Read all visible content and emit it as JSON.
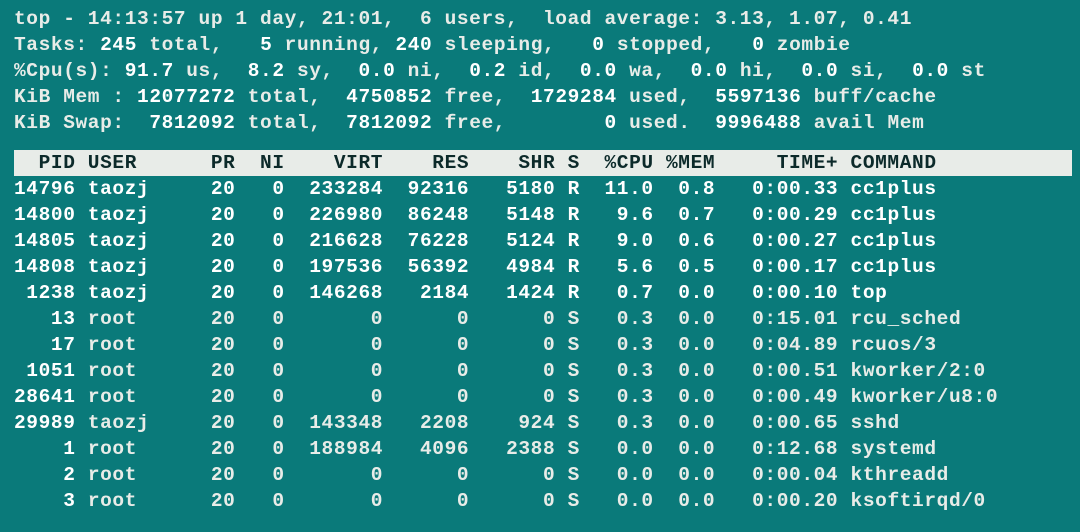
{
  "header": {
    "line1": "top - 14:13:57 up 1 day, 21:01,  6 users,  load average: 3.13, 1.07, 0.41",
    "line2_pre": "Tasks: ",
    "line2_total": "245",
    "line2_post_total": " total,   ",
    "line2_running": "5",
    "line2_post_running": " running, ",
    "line2_sleeping": "240",
    "line2_post_sleeping": " sleeping,   ",
    "line2_stopped": "0",
    "line2_post_stopped": " stopped,   ",
    "line2_zombie": "0",
    "line2_post_zombie": " zombie",
    "line3_pre": "%Cpu(s): ",
    "line3_us": "91.7",
    "line3_post_us": " us,  ",
    "line3_sy": "8.2",
    "line3_post_sy": " sy,  ",
    "line3_ni": "0.0",
    "line3_post_ni": " ni,  ",
    "line3_id": "0.2",
    "line3_post_id": " id,  ",
    "line3_wa": "0.0",
    "line3_post_wa": " wa,  ",
    "line3_hi": "0.0",
    "line3_post_hi": " hi,  ",
    "line3_si": "0.0",
    "line3_post_si": " si,  ",
    "line3_st": "0.0",
    "line3_post_st": " st",
    "line4_pre": "KiB Mem : ",
    "line4_total": "12077272",
    "line4_post_total": " total,  ",
    "line4_free": "4750852",
    "line4_post_free": " free,  ",
    "line4_used": "1729284",
    "line4_post_used": " used,  ",
    "line4_buff": "5597136",
    "line4_post_buff": " buff/cache",
    "line5_pre": "KiB Swap:  ",
    "line5_total": "7812092",
    "line5_post_total": " total,  ",
    "line5_free": "7812092",
    "line5_post_free": " free,        ",
    "line5_used": "0",
    "line5_post_used": " used.  ",
    "line5_avail": "9996488",
    "line5_post_avail": " avail Mem"
  },
  "columns": "  PID USER      PR  NI    VIRT    RES    SHR S  %CPU %MEM     TIME+ COMMAND     ",
  "rows": [
    {
      "pid": "14796",
      "user": "taozj",
      "pr": "20",
      "ni": "0",
      "virt": "233284",
      "res": "92316",
      "shr": "5180",
      "s": "R",
      "cpu": "11.0",
      "mem": "0.8",
      "time": "0:00.33",
      "cmd": "cc1plus",
      "bold": true
    },
    {
      "pid": "14800",
      "user": "taozj",
      "pr": "20",
      "ni": "0",
      "virt": "226980",
      "res": "86248",
      "shr": "5148",
      "s": "R",
      "cpu": "9.6",
      "mem": "0.7",
      "time": "0:00.29",
      "cmd": "cc1plus",
      "bold": true
    },
    {
      "pid": "14805",
      "user": "taozj",
      "pr": "20",
      "ni": "0",
      "virt": "216628",
      "res": "76228",
      "shr": "5124",
      "s": "R",
      "cpu": "9.0",
      "mem": "0.6",
      "time": "0:00.27",
      "cmd": "cc1plus",
      "bold": true
    },
    {
      "pid": "14808",
      "user": "taozj",
      "pr": "20",
      "ni": "0",
      "virt": "197536",
      "res": "56392",
      "shr": "4984",
      "s": "R",
      "cpu": "5.6",
      "mem": "0.5",
      "time": "0:00.17",
      "cmd": "cc1plus",
      "bold": true
    },
    {
      "pid": "1238",
      "user": "taozj",
      "pr": "20",
      "ni": "0",
      "virt": "146268",
      "res": "2184",
      "shr": "1424",
      "s": "R",
      "cpu": "0.7",
      "mem": "0.0",
      "time": "0:00.10",
      "cmd": "top",
      "bold": true
    },
    {
      "pid": "13",
      "user": "root",
      "pr": "20",
      "ni": "0",
      "virt": "0",
      "res": "0",
      "shr": "0",
      "s": "S",
      "cpu": "0.3",
      "mem": "0.0",
      "time": "0:15.01",
      "cmd": "rcu_sched",
      "bold": false
    },
    {
      "pid": "17",
      "user": "root",
      "pr": "20",
      "ni": "0",
      "virt": "0",
      "res": "0",
      "shr": "0",
      "s": "S",
      "cpu": "0.3",
      "mem": "0.0",
      "time": "0:04.89",
      "cmd": "rcuos/3",
      "bold": false
    },
    {
      "pid": "1051",
      "user": "root",
      "pr": "20",
      "ni": "0",
      "virt": "0",
      "res": "0",
      "shr": "0",
      "s": "S",
      "cpu": "0.3",
      "mem": "0.0",
      "time": "0:00.51",
      "cmd": "kworker/2:0",
      "bold": false
    },
    {
      "pid": "28641",
      "user": "root",
      "pr": "20",
      "ni": "0",
      "virt": "0",
      "res": "0",
      "shr": "0",
      "s": "S",
      "cpu": "0.3",
      "mem": "0.0",
      "time": "0:00.49",
      "cmd": "kworker/u8:0",
      "bold": false
    },
    {
      "pid": "29989",
      "user": "taozj",
      "pr": "20",
      "ni": "0",
      "virt": "143348",
      "res": "2208",
      "shr": "924",
      "s": "S",
      "cpu": "0.3",
      "mem": "0.0",
      "time": "0:00.65",
      "cmd": "sshd",
      "bold": false
    },
    {
      "pid": "1",
      "user": "root",
      "pr": "20",
      "ni": "0",
      "virt": "188984",
      "res": "4096",
      "shr": "2388",
      "s": "S",
      "cpu": "0.0",
      "mem": "0.0",
      "time": "0:12.68",
      "cmd": "systemd",
      "bold": false
    },
    {
      "pid": "2",
      "user": "root",
      "pr": "20",
      "ni": "0",
      "virt": "0",
      "res": "0",
      "shr": "0",
      "s": "S",
      "cpu": "0.0",
      "mem": "0.0",
      "time": "0:00.04",
      "cmd": "kthreadd",
      "bold": false
    },
    {
      "pid": "3",
      "user": "root",
      "pr": "20",
      "ni": "0",
      "virt": "0",
      "res": "0",
      "shr": "0",
      "s": "S",
      "cpu": "0.0",
      "mem": "0.0",
      "time": "0:00.20",
      "cmd": "ksoftirqd/0",
      "bold": false
    }
  ]
}
